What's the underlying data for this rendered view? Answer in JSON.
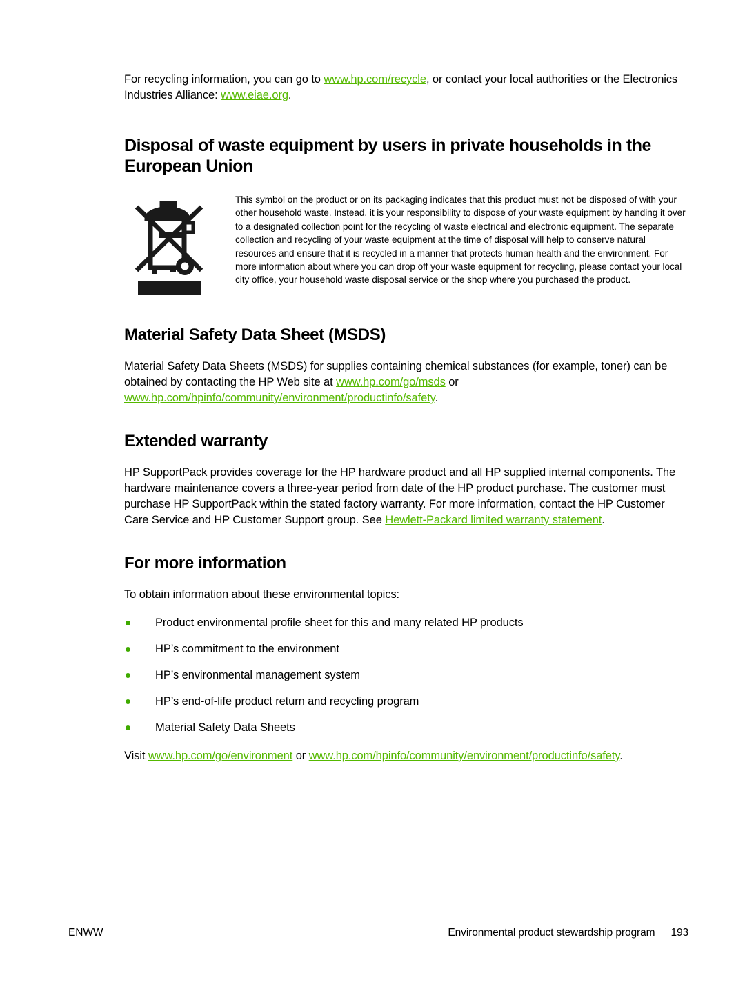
{
  "document": {
    "intro": {
      "text_before_link1": "For recycling information, you can go to ",
      "link1": "www.hp.com/recycle",
      "text_between": ", or contact your local authorities or the Electronics Industries Alliance: ",
      "link2": "www.eiae.org",
      "text_after": "."
    },
    "weee_section": {
      "heading": "Disposal of waste equipment by users in private households in the European Union",
      "symbol_name": "weee-crossed-out-wheelie-bin",
      "paragraph": "This symbol on the product or on its packaging indicates that this product must not be disposed of with your other household waste. Instead, it is your responsibility to dispose of your waste equipment by handing it over to a designated collection point for the recycling of waste electrical and electronic equipment. The separate collection and recycling of your waste equipment at the time of disposal will help to conserve natural resources and ensure that it is recycled in a manner that protects human health and the environment. For more information about where you can drop off your waste equipment for recycling, please contact your local city office, your household waste disposal service or the shop where you purchased the product."
    },
    "msds_section": {
      "heading": "Material Safety Data Sheet (MSDS)",
      "text_before_link1": "Material Safety Data Sheets (MSDS) for supplies containing chemical substances (for example, toner) can be obtained by contacting the HP Web site at ",
      "link1": "www.hp.com/go/msds",
      "text_between": " or ",
      "link2": "www.hp.com/hpinfo/community/environment/productinfo/safety",
      "text_after": "."
    },
    "warranty_section": {
      "heading": "Extended warranty",
      "text_before_link": "HP SupportPack provides coverage for the HP hardware product and all HP supplied internal components. The hardware maintenance covers a three-year period from date of the HP product purchase. The customer must purchase HP SupportPack within the stated factory warranty. For more information, contact the HP Customer Care Service and HP Customer Support group. See ",
      "link": "Hewlett-Packard limited warranty statement",
      "text_after": "."
    },
    "more_info_section": {
      "heading": "For more information",
      "lead_in": "To obtain information about these environmental topics:",
      "bullets": [
        "Product environmental profile sheet for this and many related HP products",
        "HP’s commitment to the environment",
        "HP’s environmental management system",
        "HP’s end-of-life product return and recycling program",
        "Material Safety Data Sheets"
      ],
      "visit_prefix": "Visit ",
      "visit_link1": "www.hp.com/go/environment",
      "visit_between": " or ",
      "visit_link2": "www.hp.com/hpinfo/community/environment/productinfo/safety",
      "visit_suffix": "."
    },
    "footer": {
      "left": "ENWW",
      "right_title": "Environmental product stewardship program",
      "page_number": "193"
    },
    "colors": {
      "link_green": "#55b800",
      "bullet_green": "#3faa00",
      "text_black": "#000000",
      "page_background": "#ffffff"
    }
  }
}
